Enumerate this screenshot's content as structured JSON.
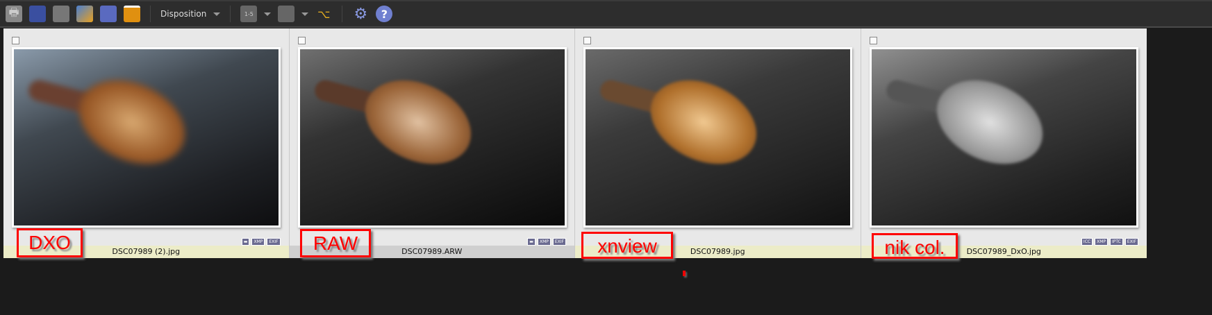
{
  "toolbar": {
    "items": [
      "print-icon",
      "scanner-icon",
      "convert-icon",
      "slideshow-icon",
      "capture-icon",
      "wallpaper-icon"
    ],
    "disposition_label": "Disposition",
    "settings": "gear-icon",
    "help": "help-icon"
  },
  "thumbnails": [
    {
      "filename": "DSC07989 (2).jpg",
      "label": "DXO",
      "badges": [
        "▬",
        "XMP",
        "EXIF"
      ],
      "tint": "#9a5a28"
    },
    {
      "filename": "DSC07989.ARW",
      "label": "RAW",
      "badges": [
        "▬",
        "XMP",
        "EXIF"
      ],
      "tint": "#9a6438"
    },
    {
      "filename": "DSC07989.jpg",
      "label": "xnview",
      "badges": [],
      "tint": "#b0702c"
    },
    {
      "filename": "DSC07989_DxO.jpg",
      "label": "nik col.",
      "badges": [
        "ICC",
        "XMP",
        "IPTC",
        "EXIF"
      ],
      "tint": "#9a9a9a"
    }
  ]
}
